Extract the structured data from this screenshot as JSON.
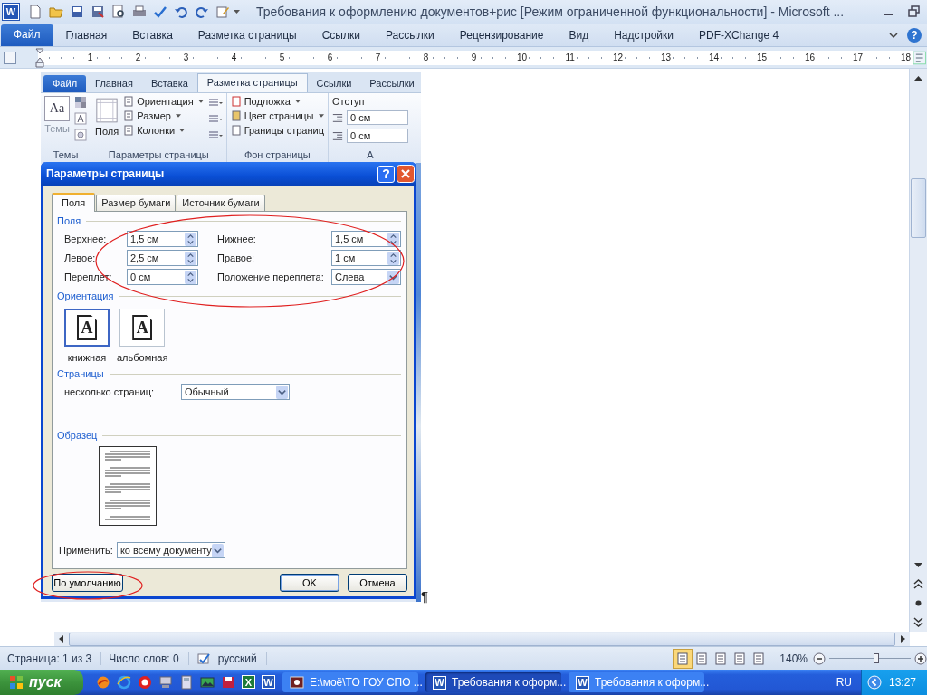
{
  "window": {
    "app_icon": "W",
    "title": "Требования к оформлению документов+рис [Режим ограниченной функциональности] - Microsoft ..."
  },
  "ribbon": {
    "tabs": [
      {
        "label": "Файл",
        "kind": "file"
      },
      {
        "label": "Главная",
        "kind": "tab",
        "selected": false
      },
      {
        "label": "Вставка",
        "kind": "tab",
        "selected": false
      },
      {
        "label": "Разметка страницы",
        "kind": "tab",
        "selected": false
      },
      {
        "label": "Ссылки",
        "kind": "tab",
        "selected": false
      },
      {
        "label": "Рассылки",
        "kind": "tab",
        "selected": false
      },
      {
        "label": "Рецензирование",
        "kind": "tab",
        "selected": false
      },
      {
        "label": "Вид",
        "kind": "tab",
        "selected": false
      },
      {
        "label": "Надстройки",
        "kind": "tab",
        "selected": false
      },
      {
        "label": "PDF-XChange 4",
        "kind": "tab",
        "selected": false
      }
    ],
    "help": "?"
  },
  "ruler": {
    "numbers": [
      "1",
      "2",
      "3",
      "4",
      "5",
      "6",
      "7",
      "8",
      "9",
      "10",
      "11",
      "12",
      "13",
      "14",
      "15",
      "16",
      "17",
      "18"
    ]
  },
  "document": {
    "end_mark": "¶",
    "screenshot": {
      "tabs": [
        {
          "label": "Файл",
          "kind": "file"
        },
        {
          "label": "Главная",
          "kind": "tab",
          "selected": false
        },
        {
          "label": "Вставка",
          "kind": "tab",
          "selected": false
        },
        {
          "label": "Разметка страницы",
          "kind": "tab",
          "selected": true
        },
        {
          "label": "Ссылки",
          "kind": "tab",
          "selected": false
        },
        {
          "label": "Рассылки",
          "kind": "tab",
          "selected": false
        }
      ],
      "groups": [
        {
          "kind": "themes",
          "label": "Темы",
          "button": "Темы",
          "glyph": "Aa"
        },
        {
          "kind": "page_setup",
          "label": "Параметры страницы",
          "button": "Поля",
          "items": [
            "Ориентация",
            "Размер",
            "Колонки"
          ]
        },
        {
          "kind": "background",
          "label": "Фон страницы",
          "items": [
            "Подложка",
            "Цвет страницы",
            "Границы страниц"
          ]
        },
        {
          "kind": "paragraph",
          "label": "А",
          "title": "Отступ",
          "fields": [
            "0 см",
            "0 см"
          ]
        }
      ],
      "dialog": {
        "title": "Параметры страницы",
        "help": "?",
        "tabs": [
          {
            "label": "Поля",
            "selected": true
          },
          {
            "label": "Размер бумаги",
            "selected": false
          },
          {
            "label": "Источник бумаги",
            "selected": false
          }
        ],
        "margins": {
          "title": "Поля",
          "highlighted": true,
          "fields": [
            {
              "label": "Верхнее:",
              "value": "1,5 см",
              "kind": "spin"
            },
            {
              "label": "Нижнее:",
              "value": "1,5 см",
              "kind": "spin"
            },
            {
              "label": "Левое:",
              "value": "2,5 см",
              "kind": "spin"
            },
            {
              "label": "Правое:",
              "value": "1 см",
              "kind": "spin"
            },
            {
              "label": "Переплет:",
              "value": "0 см",
              "kind": "spin"
            },
            {
              "label": "Положение переплета:",
              "value": "Слева",
              "kind": "dropdown"
            }
          ]
        },
        "orientation": {
          "title": "Ориентация",
          "options": [
            {
              "label": "книжная",
              "glyph": "A",
              "selected": true
            },
            {
              "label": "альбомная",
              "glyph": "A",
              "selected": false
            }
          ]
        },
        "pages": {
          "title": "Страницы",
          "label": "несколько страниц:",
          "value": "Обычный"
        },
        "preview": {
          "title": "Образец"
        },
        "apply": {
          "label": "Применить:",
          "value": "ко всему документу"
        },
        "buttons": [
          {
            "label": "По умолчанию",
            "kind": "default",
            "highlighted": true
          },
          {
            "label": "OK",
            "kind": "ok",
            "highlighted": false
          },
          {
            "label": "Отмена",
            "kind": "cancel",
            "highlighted": false
          }
        ]
      }
    }
  },
  "status_bar": {
    "page": "Страница: 1 из 3",
    "words": "Число слов: 0",
    "language": "русский",
    "views": [
      {
        "selected": true
      },
      {
        "selected": false
      },
      {
        "selected": false
      },
      {
        "selected": false
      },
      {
        "selected": false
      }
    ],
    "zoom": "140%",
    "zoom_slider": {
      "level": 0.58
    }
  },
  "taskbar": {
    "start": "пуск",
    "quick_launch": [
      {
        "kind": "fox"
      },
      {
        "kind": "browser"
      },
      {
        "kind": "stop"
      },
      {
        "kind": "computer"
      },
      {
        "kind": "calculator"
      },
      {
        "kind": "image"
      },
      {
        "kind": "floppy"
      },
      {
        "kind": "sheet",
        "glyph": "X"
      },
      {
        "kind": "doc",
        "glyph": "W"
      }
    ],
    "windows": [
      {
        "label": "E:\\моё\\ТО ГОУ СПО ...",
        "kind": "folder",
        "selected": false
      },
      {
        "label": "Требования к оформ...",
        "kind": "doc",
        "glyph": "W",
        "selected": true
      },
      {
        "label": "Требования к оформ...",
        "kind": "doc",
        "glyph": "W",
        "selected": false
      }
    ],
    "language": "RU",
    "clock": "13:27"
  }
}
